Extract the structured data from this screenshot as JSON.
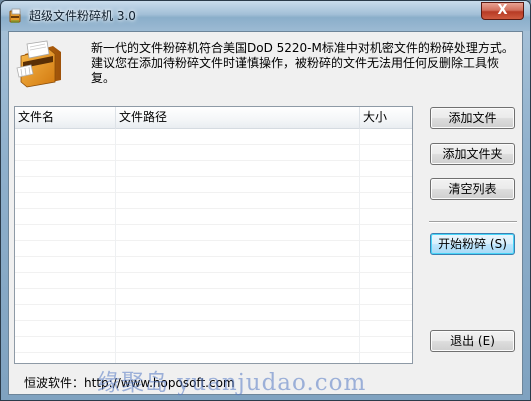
{
  "window": {
    "title": "超级文件粉碎机  3.0",
    "close_glyph": "X"
  },
  "header": {
    "description": "新一代的文件粉碎机符合美国DoD 5220-M标准中对机密文件的粉碎处理方式。建议您在添加待粉碎文件时谨慎操作，被粉碎的文件无法用任何反删除工具恢复。"
  },
  "file_list": {
    "columns": [
      "文件名",
      "文件路径",
      "大小"
    ],
    "rows": []
  },
  "buttons": {
    "add_file": "添加文件",
    "add_folder": "添加文件夹",
    "clear_list": "清空列表",
    "start_shred": "开始粉碎 (S)",
    "exit": "退出 (E)"
  },
  "footer": {
    "company_label": "恒波软件：",
    "website": "http://www.hoposoft.com"
  },
  "watermark": {
    "text": "缘聚岛 yuanjudao.com"
  },
  "colors": {
    "title_bar": "#a2bfd7",
    "close_button": "#c84a33",
    "client_background": "#f0f0f0",
    "start_button_highlight": "#bee6fd"
  },
  "icons": {
    "app": "shredder-small-icon",
    "logo": "shredder-icon"
  }
}
